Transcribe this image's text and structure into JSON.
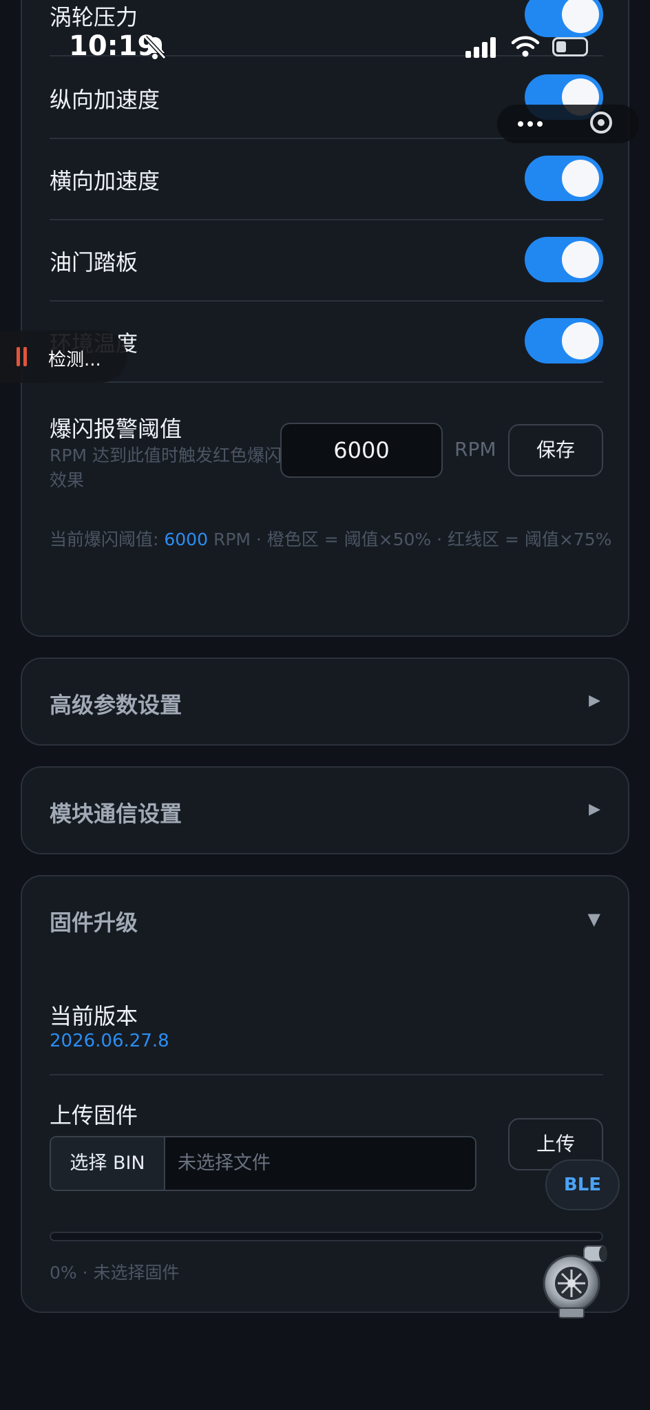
{
  "status_bar": {
    "time": "10:19"
  },
  "sensor_rows": [
    {
      "label": "涡轮压力",
      "enabled": true
    },
    {
      "label": "纵向加速度",
      "enabled": true
    },
    {
      "label": "横向加速度",
      "enabled": true
    },
    {
      "label": "油门踏板",
      "enabled": true
    },
    {
      "label": "环境温度",
      "enabled": true
    }
  ],
  "flash_alert": {
    "title": "爆闪报警阈值",
    "description": "RPM 达到此值时触发红色爆闪效果",
    "value": "6000",
    "unit": "RPM",
    "save_label": "保存",
    "note_prefix": "当前爆闪阈值: ",
    "note_value": "6000",
    "note_suffix": " RPM · 橙色区 = 阈值×50% · 红线区 = 阈值×75%"
  },
  "sections": {
    "advanced": {
      "title": "高级参数设置",
      "arrow": "▶"
    },
    "comm": {
      "title": "模块通信设置",
      "arrow": "▶"
    }
  },
  "firmware": {
    "title": "固件升级",
    "arrow": "▼",
    "current_version_label": "当前版本",
    "current_version": "2026.06.27.8",
    "upload_label": "上传固件",
    "choose_button": "选择 BIN",
    "file_placeholder": "未选择文件",
    "upload_button": "上传",
    "progress": 0,
    "progress_text": "0% · 未选择固件"
  },
  "overlays": {
    "recording_label": "检测...",
    "ble_label": "BLE"
  },
  "colors": {
    "accent": "#2188f2",
    "background": "#0f1218",
    "card": "#161b22",
    "recording": "#e2553a"
  }
}
